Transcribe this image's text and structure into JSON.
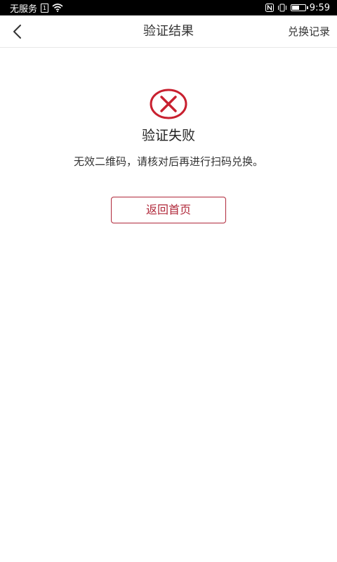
{
  "status_bar": {
    "carrier": "无服务",
    "sim_label": "1",
    "time": "9:59",
    "battery_level": 0.55
  },
  "nav": {
    "title": "验证结果",
    "right_action": "兑换记录"
  },
  "result": {
    "title": "验证失败",
    "message": "无效二维码，请核对后再进行扫码兑换。",
    "icon": "error-circle-x-icon",
    "accent_color": "#c8202f"
  },
  "actions": {
    "home_label": "返回首页"
  }
}
